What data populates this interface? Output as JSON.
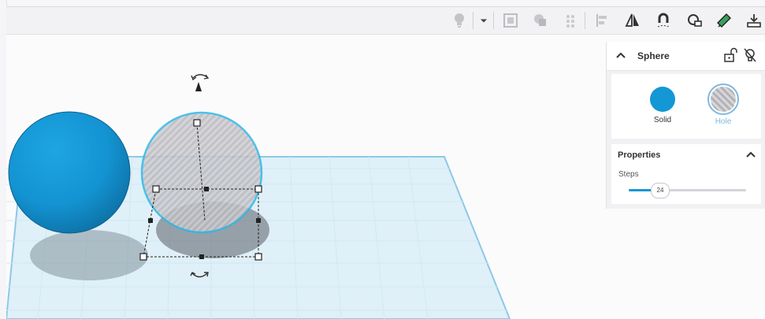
{
  "toolbar": {
    "icons": [
      "lightbulb-icon",
      "dropdown-arrow-icon",
      "group-icon",
      "ungroup-icon",
      "align-icon",
      "distribute-icon",
      "mirror-icon",
      "magnet-icon",
      "workplane-icon",
      "ruler-icon",
      "export-icon"
    ]
  },
  "inspector": {
    "title": "Sphere",
    "materials": {
      "solid_label": "Solid",
      "hole_label": "Hole",
      "selected": "Hole"
    },
    "properties": {
      "title": "Properties",
      "steps_label": "Steps",
      "steps_value": "24",
      "steps_fraction": 0.26
    }
  },
  "colors": {
    "solid": "#1497d5",
    "accent": "#1497d5",
    "grid": "#cfe9f5"
  }
}
